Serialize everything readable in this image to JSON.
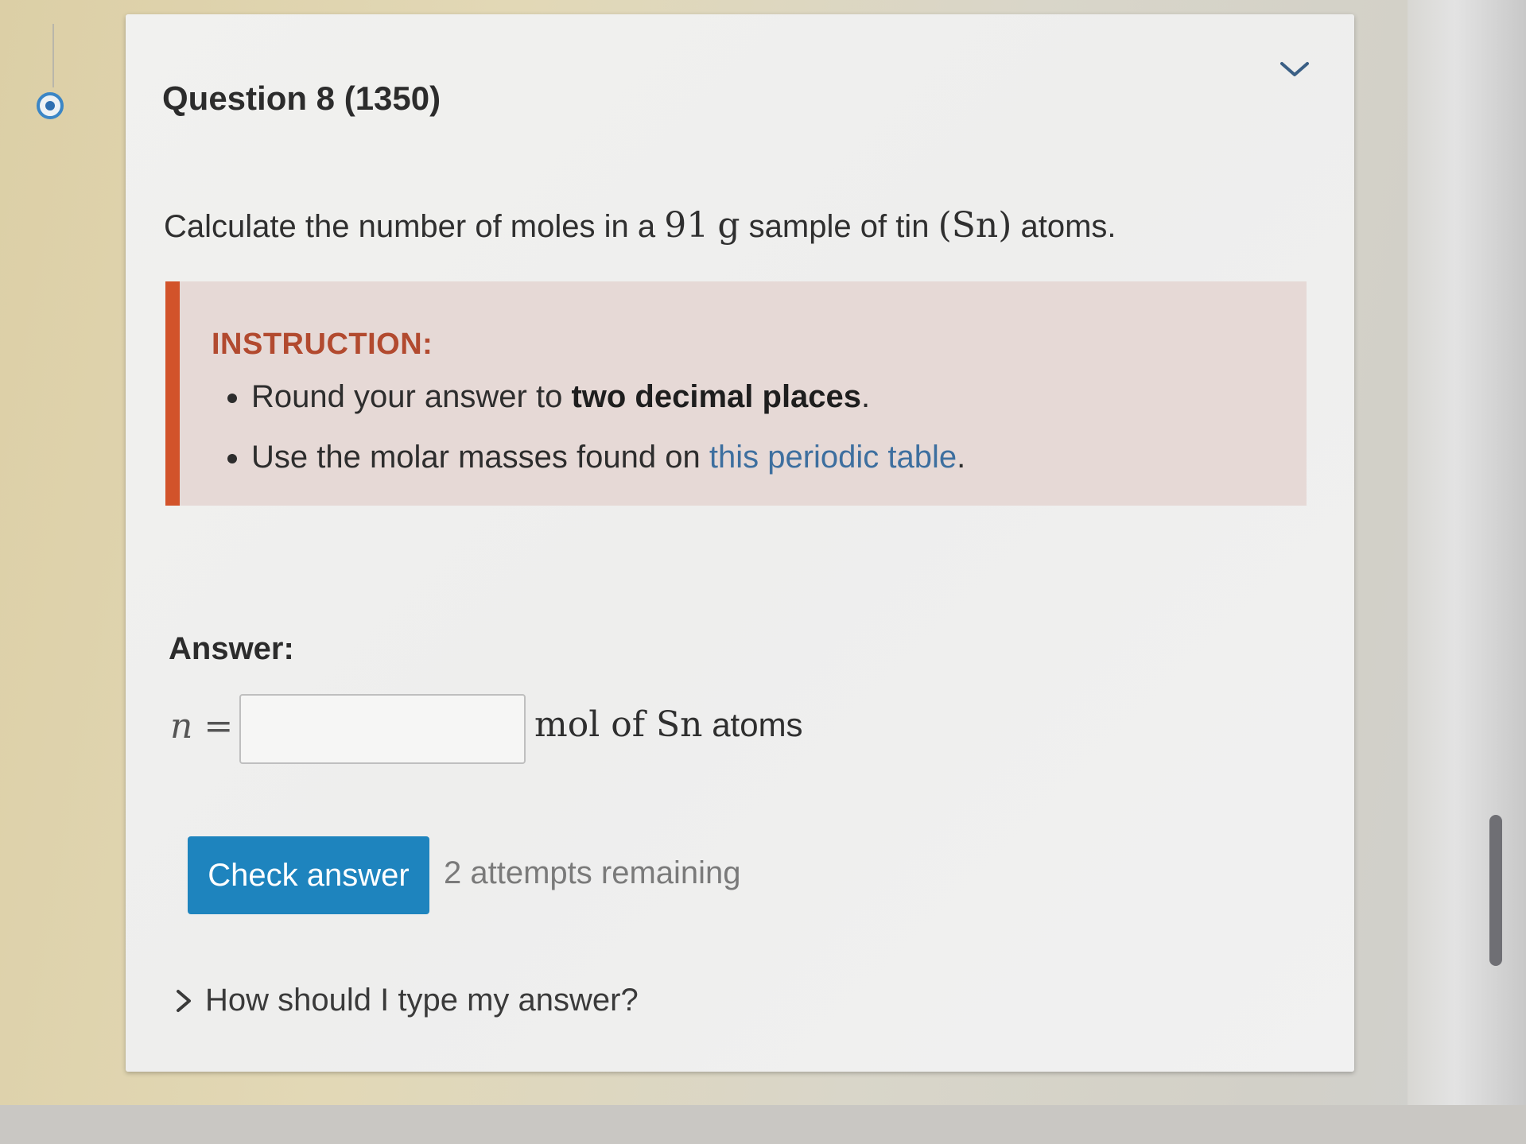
{
  "question": {
    "title": "Question 8 (1350)",
    "prompt_pre": "Calculate the number of moles in a",
    "mass_value": "91",
    "mass_unit": "g",
    "prompt_mid": "sample of tin",
    "element_symbol": "(Sn)",
    "prompt_post": "atoms."
  },
  "instruction": {
    "heading": "INSTRUCTION:",
    "item1_pre": "Round your answer to",
    "item1_bold": "two decimal places",
    "item1_post": ".",
    "item2_pre": "Use the molar masses found on",
    "item2_link": "this periodic table",
    "item2_post": "."
  },
  "answer": {
    "label": "Answer:",
    "variable": "n =",
    "input_value": "",
    "unit_math": "mol of Sn",
    "unit_text": "atoms"
  },
  "actions": {
    "check_label": "Check answer",
    "attempts_text": "2 attempts remaining"
  },
  "help": {
    "label": "How should I type my answer?"
  },
  "icons": {
    "collapse": "chevron-down-icon",
    "help_expand": "chevron-right-icon",
    "status": "radio-selected-icon"
  },
  "colors": {
    "accent": "#1e84be",
    "instruction_bar": "#d2532a",
    "instruction_heading": "#b24a2f",
    "instruction_bg": "#e6d9d6",
    "link": "#3d6f9f"
  }
}
